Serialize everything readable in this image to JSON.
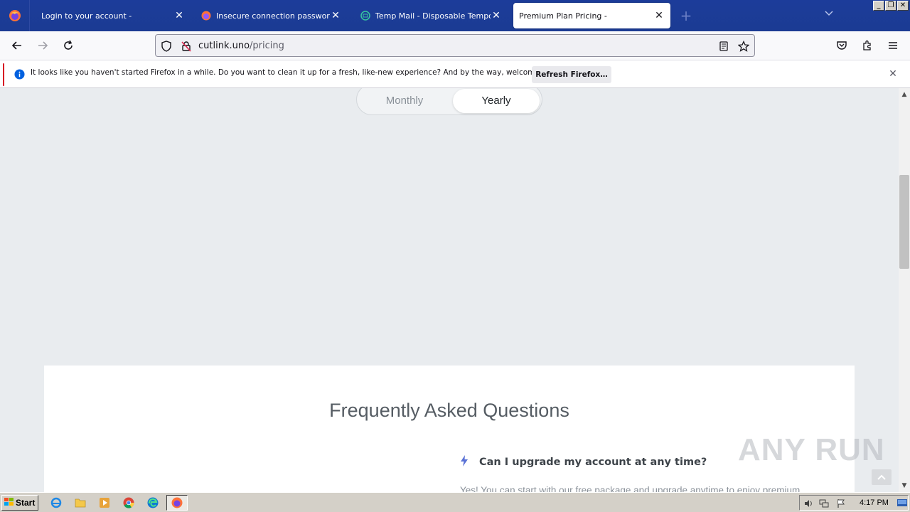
{
  "browser": {
    "tabs": [
      {
        "title": "Login to your account -",
        "active": false,
        "icon": "firefox-icon"
      },
      {
        "title": "Insecure connection password war",
        "active": false,
        "icon": "firefox-icon"
      },
      {
        "title": "Temp Mail - Disposable Temporary E",
        "active": false,
        "icon": "tempmail-icon"
      },
      {
        "title": "Premium Plan Pricing -",
        "active": true,
        "icon": "none"
      }
    ],
    "new_tab_label": "+",
    "url": {
      "host": "cutlink.uno",
      "path": "/pricing"
    }
  },
  "notification": {
    "message": "It looks like you haven't started Firefox in a while. Do you want to clean it up for a fresh, like-new experience? And by the way, welcome back!",
    "button_label": "Refresh Firefox…"
  },
  "page": {
    "billing_toggle": {
      "monthly_label": "Monthly",
      "yearly_label": "Yearly",
      "selected": "Yearly"
    },
    "faq": {
      "title": "Frequently Asked Questions",
      "question": "Can I upgrade my account at any time?",
      "answer_preview": "Yes! You can start with our free package and upgrade anytime to enjoy premium"
    },
    "watermark": "ANY RUN"
  },
  "taskbar": {
    "start_label": "Start",
    "clock": "4:17 PM"
  },
  "colors": {
    "tabstrip": "#1c3c9a",
    "page_bg": "#e9ecef",
    "accent_icon": "#4a63c8"
  }
}
